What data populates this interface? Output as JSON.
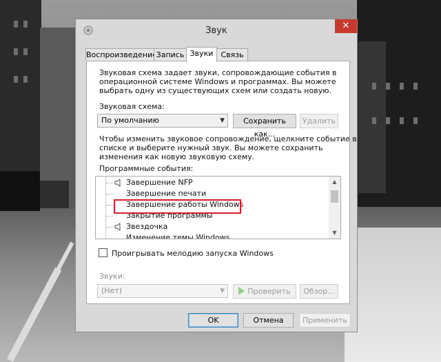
{
  "dialog": {
    "title": "Звук",
    "close_symbol": "✕",
    "tabs": [
      {
        "label": "Воспроизведение"
      },
      {
        "label": "Запись"
      },
      {
        "label": "Звуки"
      },
      {
        "label": "Связь"
      }
    ],
    "active_tab": "Звуки"
  },
  "sounds": {
    "description": [
      "Звуковая схема задает звуки, сопровождающие события в",
      "операционной системе Windows и программах. Вы можете",
      "выбрать одну из существующих схем или создать новую."
    ],
    "scheme_label": "Звуковая схема:",
    "scheme_value": "По умолчанию",
    "save_as_label": "Сохранить как...",
    "delete_label": "Удалить",
    "instructions": [
      "Чтобы изменить звуковое сопровождение, щелкните событие в",
      "списке и выберите нужный звук. Вы можете сохранить",
      "изменения как новую звуковую схему."
    ],
    "events_label": "Программные события:",
    "events": [
      {
        "label": "Завершение NFP",
        "icon": "speaker-icon"
      },
      {
        "label": "Завершение печати",
        "icon": ""
      },
      {
        "label": "Завершение работы Windows",
        "icon": ""
      },
      {
        "label": "Закрытие программы",
        "icon": ""
      },
      {
        "label": "Звездочка",
        "icon": "speaker-icon"
      },
      {
        "label": "Изменение темы Windows",
        "icon": ""
      }
    ],
    "highlighted_event": "Завершение работы Windows",
    "startup_checkbox_label": "Проигрывать мелодию запуска Windows",
    "startup_checked": false,
    "sounds_label": "Звуки:",
    "sound_value": "(Нет)",
    "test_label": "Проверить",
    "browse_label": "Обзор..."
  },
  "footer": {
    "ok_label": "OK",
    "cancel_label": "Отмена",
    "apply_label": "Применить"
  },
  "colors": {
    "highlight": "#d21f27",
    "close_button": "#c7392c"
  }
}
